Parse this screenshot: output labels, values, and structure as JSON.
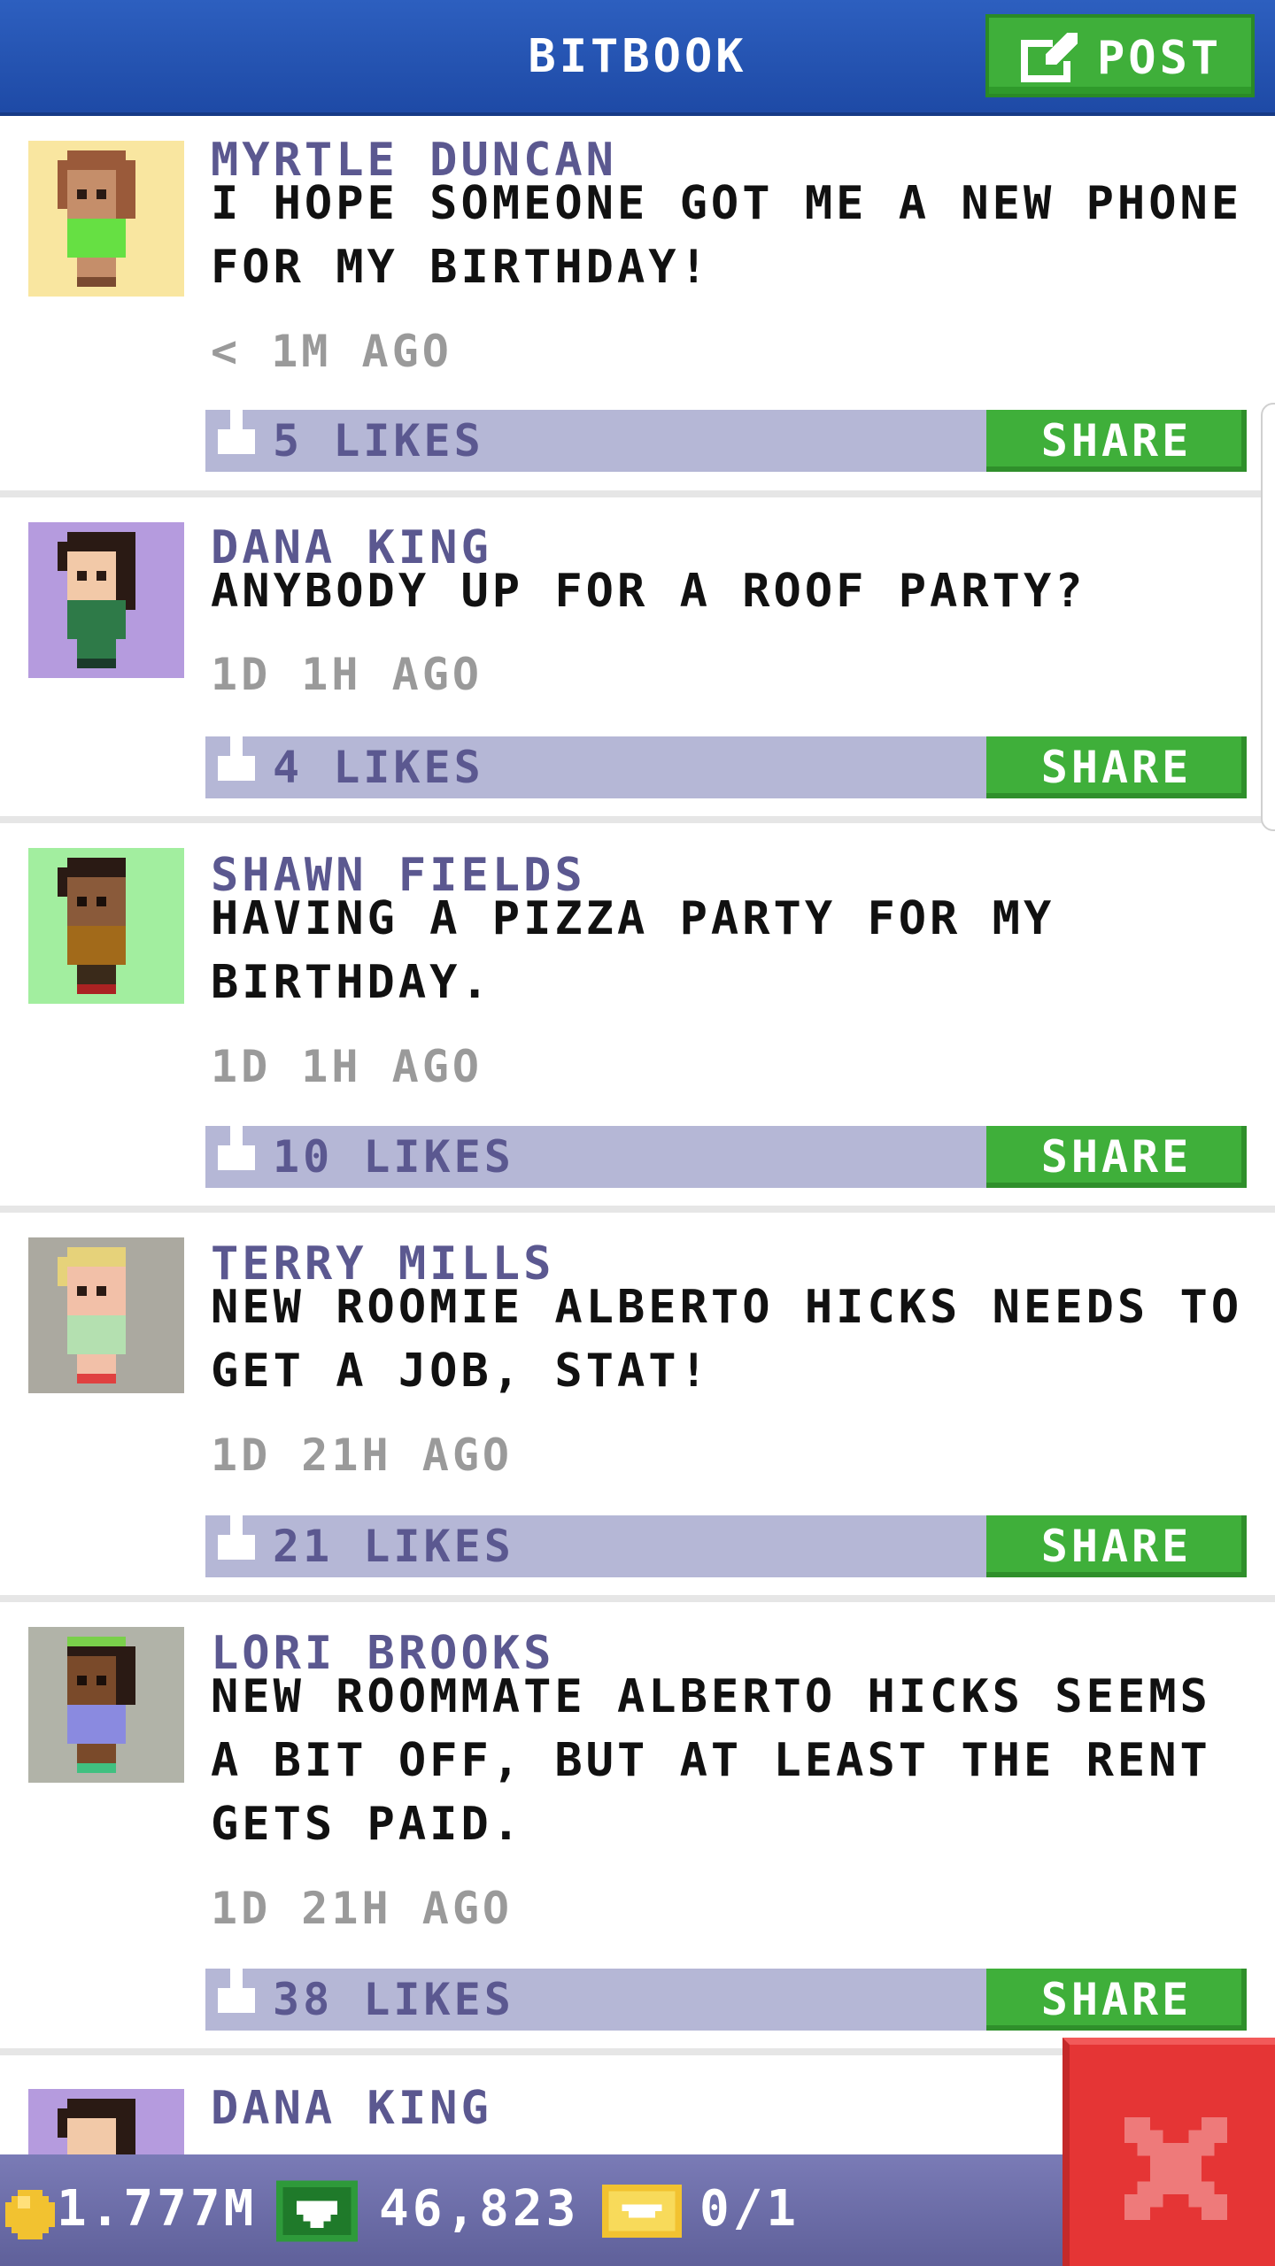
{
  "header": {
    "title": "BITBOOK",
    "post_label": "POST"
  },
  "posts": [
    {
      "name": "MYRTLE DUNCAN",
      "text": "I HOPE SOMEONE GOT ME A NEW PHONE FOR MY BIRTHDAY!",
      "time": "< 1M AGO",
      "likes": "5 LIKES",
      "share": "SHARE",
      "avatar_bg": "#f9e6a0"
    },
    {
      "name": "DANA KING",
      "text": "ANYBODY UP FOR A ROOF PARTY?",
      "time": "1D 1H AGO",
      "likes": "4 LIKES",
      "share": "SHARE",
      "avatar_bg": "#b59bde"
    },
    {
      "name": "SHAWN FIELDS",
      "text": "HAVING A PIZZA PARTY FOR MY BIRTHDAY.",
      "time": "1D 1H AGO",
      "likes": "10 LIKES",
      "share": "SHARE",
      "avatar_bg": "#a2ee9f"
    },
    {
      "name": "TERRY MILLS",
      "text": "NEW ROOMIE ALBERTO HICKS NEEDS TO GET A JOB, STAT!",
      "time": "1D 21H AGO",
      "likes": "21 LIKES",
      "share": "SHARE",
      "avatar_bg": "#aba9a0"
    },
    {
      "name": "LORI BROOKS",
      "text": "NEW ROOMMATE ALBERTO HICKS SEEMS A BIT OFF, BUT AT LEAST THE RENT GETS PAID.",
      "time": "1D 21H AGO",
      "likes": "38 LIKES",
      "share": "SHARE",
      "avatar_bg": "#b1b3a8"
    },
    {
      "name": "DANA KING",
      "avatar_bg": "#b59bde"
    }
  ],
  "status": {
    "coins": "1.777M",
    "bux": "46,823",
    "tickets": "0/1"
  },
  "colors": {
    "header_blue": "#2557b8",
    "accent_green": "#3faf3a",
    "like_bar": "#b5b7d6",
    "name_purple": "#5b5890",
    "close_red": "#e53535"
  }
}
